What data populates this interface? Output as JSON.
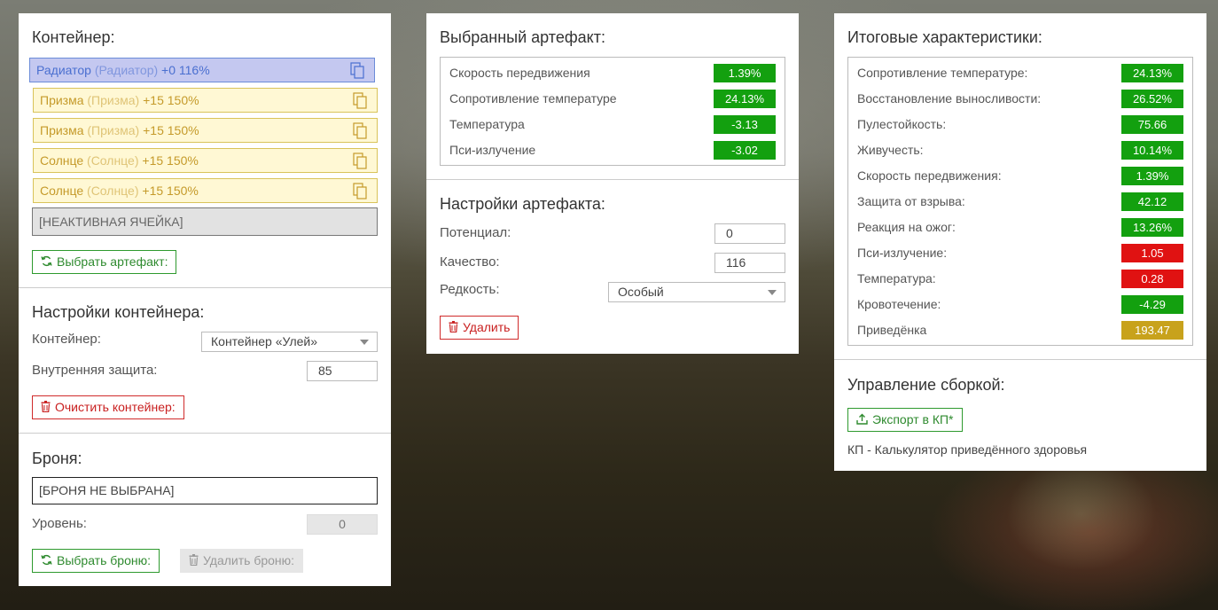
{
  "container_panel": {
    "title": "Контейнер:",
    "slots": [
      {
        "name": "Радиатор",
        "alt": "(Радиатор)",
        "info": "+0 116%",
        "style": "blue"
      },
      {
        "name": "Призма",
        "alt": "(Призма)",
        "info": "+15 150%",
        "style": "yellow"
      },
      {
        "name": "Призма",
        "alt": "(Призма)",
        "info": "+15 150%",
        "style": "yellow"
      },
      {
        "name": "Солнце",
        "alt": "(Солнце)",
        "info": "+15 150%",
        "style": "yellow"
      },
      {
        "name": "Солнце",
        "alt": "(Солнце)",
        "info": "+15 150%",
        "style": "yellow"
      },
      {
        "name": "[НЕАКТИВНАЯ ЯЧЕЙКА]",
        "style": "gray"
      }
    ],
    "choose_artifact_button": "Выбрать артефакт:"
  },
  "container_settings": {
    "title": "Настройки контейнера:",
    "container_label": "Контейнер:",
    "container_value": "Контейнер «Улей»",
    "protection_label": "Внутренняя защита:",
    "protection_value": "85",
    "clear_button": "Очистить контейнер:"
  },
  "armor": {
    "title": "Броня:",
    "value": "[БРОНЯ НЕ ВЫБРАНА]",
    "level_label": "Уровень:",
    "level_value": "0",
    "choose_button": "Выбрать броню:",
    "remove_button": "Удалить броню:"
  },
  "selected_artifact": {
    "title": "Выбранный артефакт:",
    "stats": [
      {
        "name": "Скорость передвижения",
        "value": "1.39%",
        "color": "green"
      },
      {
        "name": "Сопротивление температуре",
        "value": "24.13%",
        "color": "green"
      },
      {
        "name": "Температура",
        "value": "-3.13",
        "color": "green"
      },
      {
        "name": "Пси-излучение",
        "value": "-3.02",
        "color": "green"
      }
    ]
  },
  "artifact_settings": {
    "title": "Настройки артефакта:",
    "potential_label": "Потенциал:",
    "potential_value": "0",
    "quality_label": "Качество:",
    "quality_value": "116",
    "rarity_label": "Редкость:",
    "rarity_value": "Особый",
    "delete_button": "Удалить"
  },
  "totals": {
    "title": "Итоговые характеристики:",
    "stats": [
      {
        "name": "Сопротивление температуре:",
        "value": "24.13%",
        "color": "green"
      },
      {
        "name": "Восстановление выносливости:",
        "value": "26.52%",
        "color": "green"
      },
      {
        "name": "Пулестойкость:",
        "value": "75.66",
        "color": "green"
      },
      {
        "name": "Живучесть:",
        "value": "10.14%",
        "color": "green"
      },
      {
        "name": "Скорость передвижения:",
        "value": "1.39%",
        "color": "green"
      },
      {
        "name": "Защита от взрыва:",
        "value": "42.12",
        "color": "green"
      },
      {
        "name": "Реакция на ожог:",
        "value": "13.26%",
        "color": "green"
      },
      {
        "name": "Пси-излучение:",
        "value": "1.05",
        "color": "red"
      },
      {
        "name": "Температура:",
        "value": "0.28",
        "color": "red"
      },
      {
        "name": "Кровотечение:",
        "value": "-4.29",
        "color": "green"
      },
      {
        "name": "Приведёнка",
        "value": "193.47",
        "color": "yellow"
      }
    ]
  },
  "build_management": {
    "title": "Управление сборкой:",
    "export_button": "Экспорт в КП*",
    "note": "КП - Калькулятор приведённого здоровья"
  },
  "colors": {
    "green": "#13a00f",
    "red": "#e01212",
    "yellow": "#c8a21c",
    "accent_green": "#2e9a2e",
    "accent_red": "#d02b2b"
  }
}
